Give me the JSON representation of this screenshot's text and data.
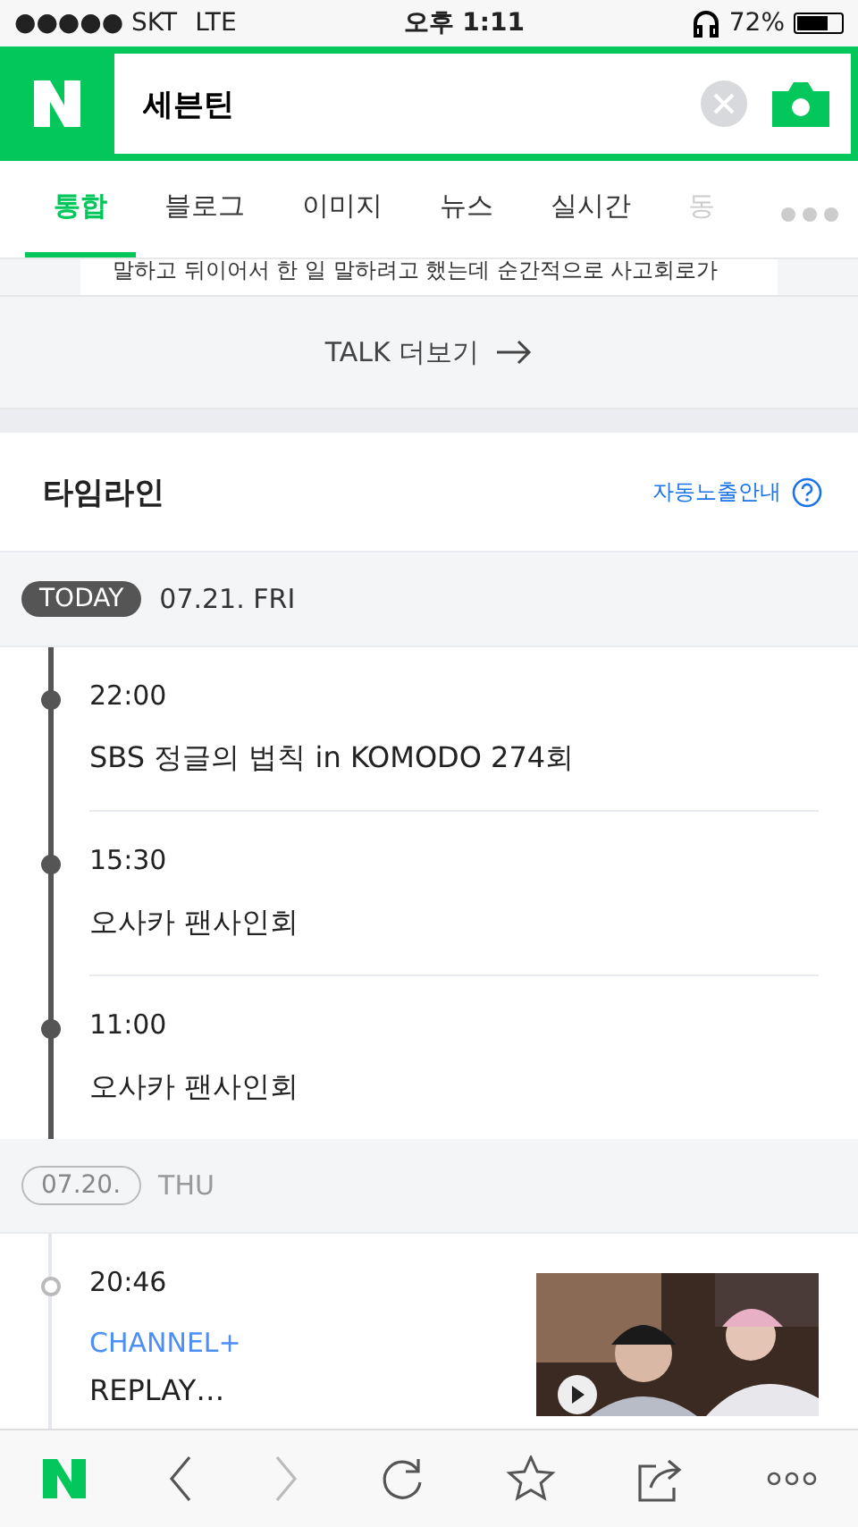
{
  "status_bar": {
    "carrier": "●●●●● SKT",
    "network": "LTE",
    "time": "오후 1:11",
    "battery": "72%"
  },
  "search": {
    "value": "세븐틴"
  },
  "tabs": [
    {
      "label": "통합",
      "selected": true
    },
    {
      "label": "블로그",
      "selected": false
    },
    {
      "label": "이미지",
      "selected": false
    },
    {
      "label": "뉴스",
      "selected": false
    },
    {
      "label": "실시간",
      "selected": false
    },
    {
      "label": "동",
      "selected": false
    }
  ],
  "talk": {
    "snippet": "말하고 뒤이어서 한 일 말하려고 했는데 순간적으로 사고회로가",
    "more": "TALK 더보기"
  },
  "timeline": {
    "title": "타임라인",
    "help": "자동노출안내",
    "days": [
      {
        "date": "07.21.",
        "weekday": "FRI",
        "today": true,
        "label": "TODAY",
        "items": [
          {
            "time": "22:00",
            "title": "SBS 정글의 법칙 in KOMODO 274회"
          },
          {
            "time": "15:30",
            "title": "오사카 팬사인회"
          },
          {
            "time": "11:00",
            "title": "오사카 팬사인회"
          }
        ]
      },
      {
        "date": "07.20.",
        "weekday": "THU",
        "today": false,
        "items": [
          {
            "time": "20:46",
            "source": "CHANNEL+",
            "title": "REPLAY…"
          }
        ]
      }
    ]
  }
}
